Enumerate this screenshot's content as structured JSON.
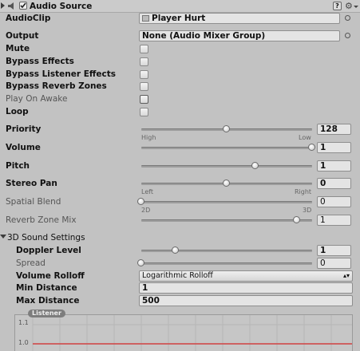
{
  "header": {
    "component_title": "Audio Source",
    "enabled": true,
    "icons": [
      "speaker-icon",
      "help-icon",
      "gear-icon"
    ]
  },
  "rows": {
    "audioclip": {
      "label": "AudioClip",
      "value": "Player Hurt"
    },
    "output": {
      "label": "Output",
      "value": "None (Audio Mixer Group)"
    },
    "mute": {
      "label": "Mute",
      "checked": false
    },
    "bypass_effects": {
      "label": "Bypass Effects",
      "checked": false
    },
    "bypass_listener_effects": {
      "label": "Bypass Listener Effects",
      "checked": false
    },
    "bypass_reverb_zones": {
      "label": "Bypass Reverb Zones",
      "checked": false
    },
    "play_on_awake": {
      "label": "Play On Awake",
      "checked": false
    },
    "loop": {
      "label": "Loop",
      "checked": false
    },
    "priority": {
      "label": "Priority",
      "value": "128",
      "fraction": 0.5,
      "min_label": "High",
      "max_label": "Low"
    },
    "volume": {
      "label": "Volume",
      "value": "1",
      "fraction": 1.0
    },
    "pitch": {
      "label": "Pitch",
      "value": "1",
      "fraction": 0.667
    },
    "stereo_pan": {
      "label": "Stereo Pan",
      "value": "0",
      "fraction": 0.5,
      "min_label": "Left",
      "max_label": "Right"
    },
    "spatial_blend": {
      "label": "Spatial Blend",
      "value": "0",
      "fraction": 0.0,
      "min_label": "2D",
      "max_label": "3D"
    },
    "reverb_zone_mix": {
      "label": "Reverb Zone Mix",
      "value": "1",
      "fraction": 0.91
    }
  },
  "sound3d": {
    "section_label": "3D Sound Settings",
    "doppler_level": {
      "label": "Doppler Level",
      "value": "1",
      "fraction": 0.2
    },
    "spread": {
      "label": "Spread",
      "value": "0",
      "fraction": 0.0
    },
    "volume_rolloff": {
      "label": "Volume Rolloff",
      "value": "Logarithmic Rolloff"
    },
    "min_distance": {
      "label": "Min Distance",
      "value": "1"
    },
    "max_distance": {
      "label": "Max Distance",
      "value": "500"
    }
  },
  "graph": {
    "listener_label": "Listener",
    "y_ticks": [
      "1.1",
      "1.0"
    ]
  }
}
